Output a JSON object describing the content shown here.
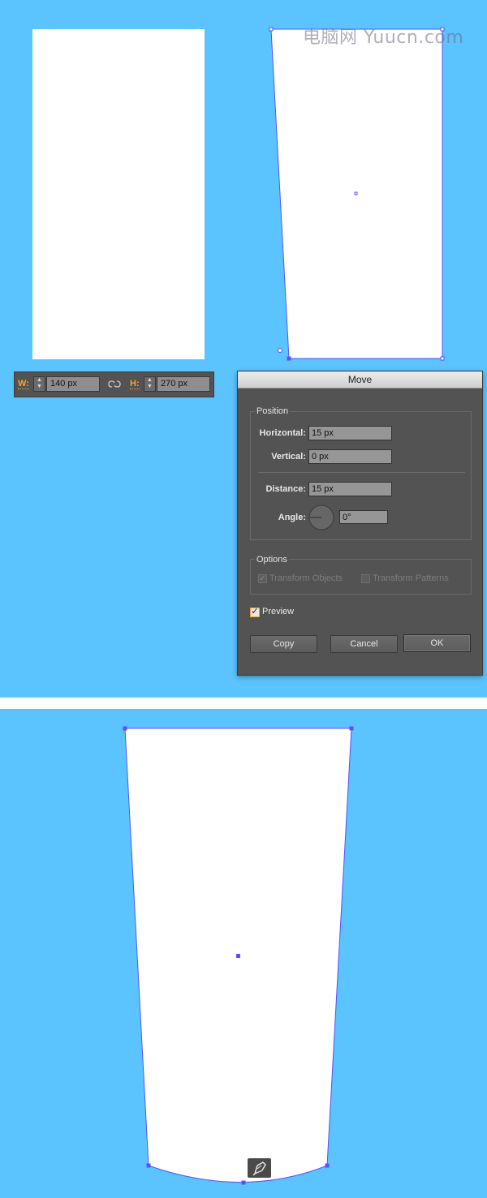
{
  "watermark": "电脑网 Yuucn.com",
  "colors": {
    "background": "#5bc4ff",
    "selection": "#5a4fff",
    "accent": "#f0a23a"
  },
  "wh_bar": {
    "w_label": "W:",
    "w_value": "140 px",
    "link_icon": "link-icon",
    "h_label": "H:",
    "h_value": "270 px"
  },
  "move_dialog": {
    "title": "Move",
    "position_group": "Position",
    "horizontal_label": "Horizontal:",
    "horizontal_value": "15 px",
    "vertical_label": "Vertical:",
    "vertical_value": "0 px",
    "distance_label": "Distance:",
    "distance_value": "15 px",
    "angle_label": "Angle:",
    "angle_value": "0°",
    "options_group": "Options",
    "transform_objects": "Transform Objects",
    "transform_objects_checked": true,
    "transform_patterns": "Transform Patterns",
    "transform_patterns_checked": false,
    "preview_label": "Preview",
    "preview_checked": true,
    "copy_button": "Copy",
    "cancel_button": "Cancel",
    "ok_button": "OK"
  },
  "tool_icon": "pen-tool-icon"
}
